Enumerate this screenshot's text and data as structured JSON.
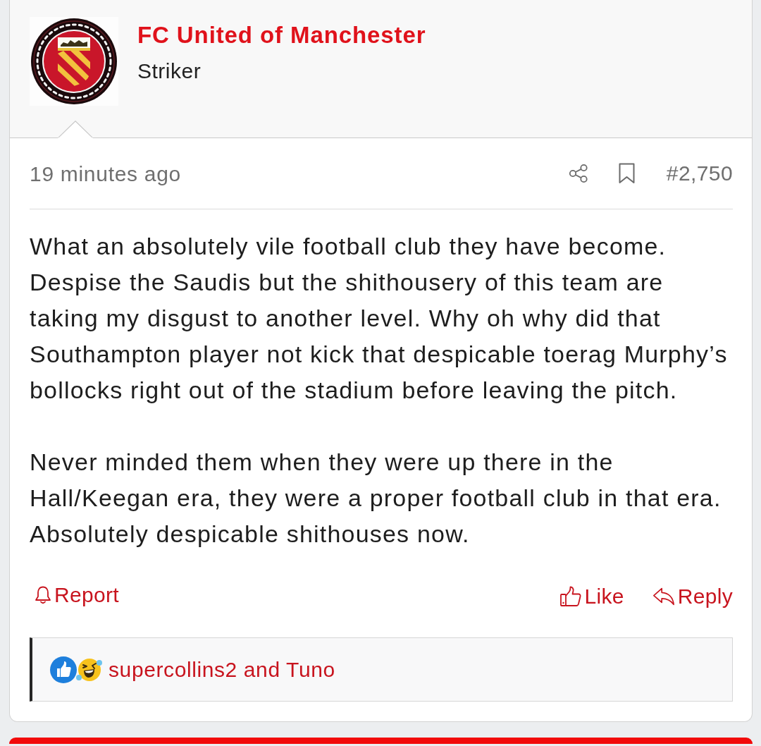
{
  "post": {
    "author": {
      "name": "FC United of Manchester",
      "title": "Striker"
    },
    "meta": {
      "time": "19 minutes ago",
      "number": "#2,750"
    },
    "body": [
      "What an absolutely vile football club they have become. Despise the Saudis but the shithousery of this team are taking my disgust to another level. Why oh why did that Southampton player not kick that despicable toerag Murphy’s bollocks right out of the stadium before leaving the pitch.",
      "Never minded them when they were up there in the Hall/Keegan era, they were a proper football club in that era. Absolutely despicable shithouses now."
    ],
    "report": {
      "label": "Report"
    },
    "actions": [
      {
        "kind": "like",
        "label": "Like"
      },
      {
        "kind": "reply",
        "label": "Reply"
      }
    ],
    "reactions": {
      "text": "supercollins2 and Tuno"
    }
  }
}
